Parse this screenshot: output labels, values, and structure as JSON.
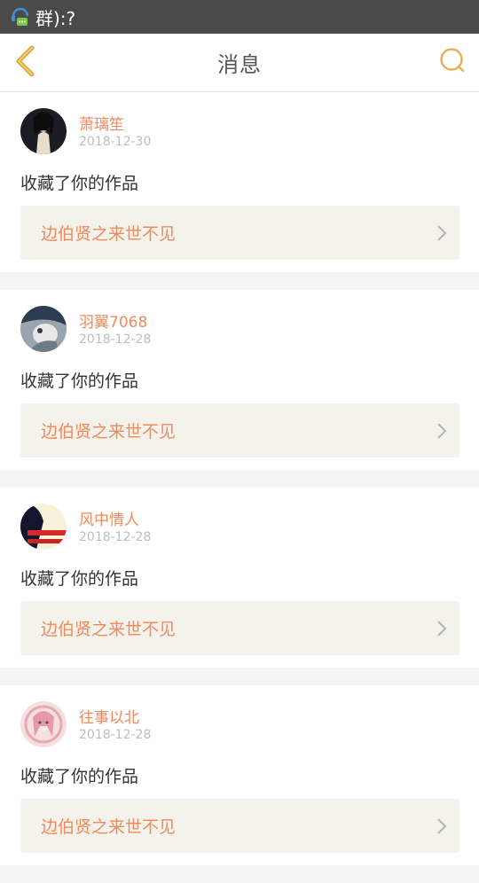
{
  "status_bar": {
    "text": "群):?",
    "icon": "chat-app-icon"
  },
  "header": {
    "title": "消息",
    "back_icon": "chevron-left-icon",
    "search_icon": "search-icon",
    "accent_color": "#f0a64a"
  },
  "messages": [
    {
      "name": "萧璃笙",
      "date": "2018-12-30",
      "action": "收藏了你的作品",
      "work_title": "边伯贤之来世不见"
    },
    {
      "name": "羽翼7068",
      "date": "2018-12-28",
      "action": "收藏了你的作品",
      "work_title": "边伯贤之来世不见"
    },
    {
      "name": "风中情人",
      "date": "2018-12-28",
      "action": "收藏了你的作品",
      "work_title": "边伯贤之来世不见"
    },
    {
      "name": "往事以北",
      "date": "2018-12-28",
      "action": "收藏了你的作品",
      "work_title": "边伯贤之来世不见"
    }
  ],
  "colors": {
    "name": "#f08a5d",
    "date": "#bdbdbd",
    "work_bg": "#f3f3ec"
  }
}
